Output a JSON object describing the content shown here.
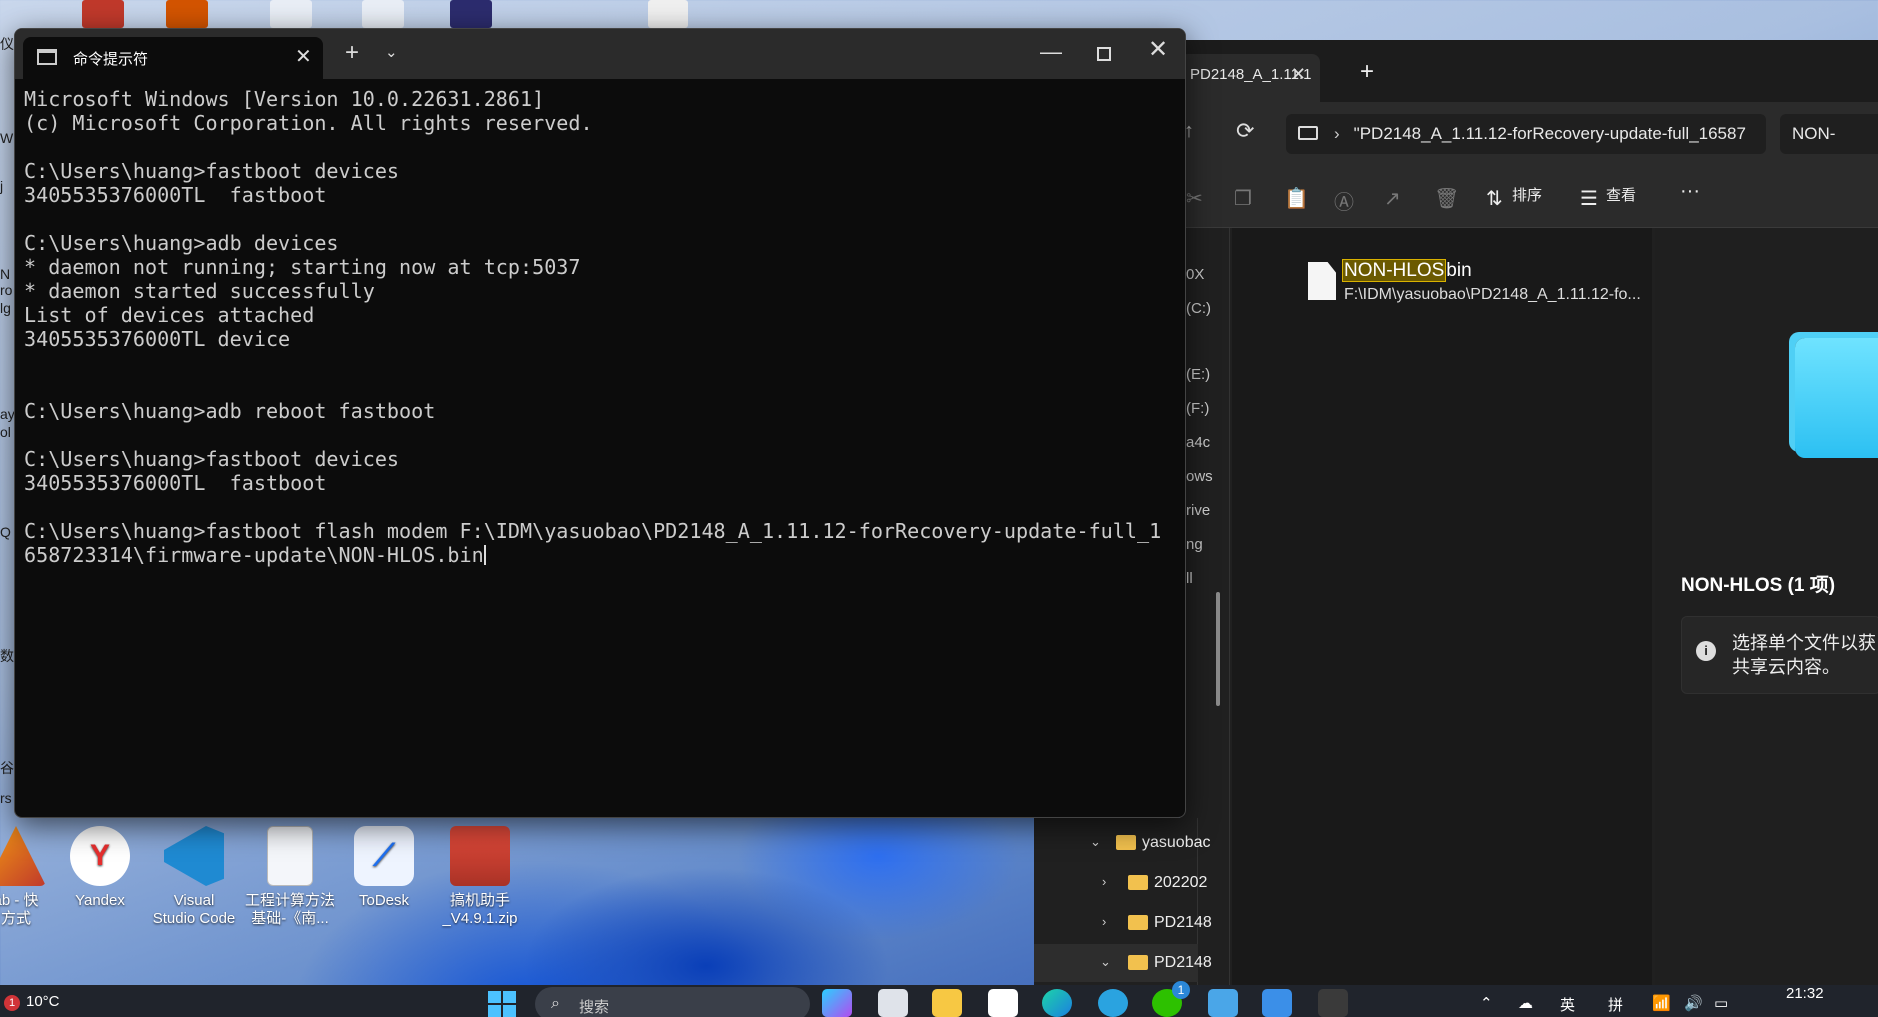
{
  "desktop": {
    "icons": [
      {
        "label": "ab - 快\n方式"
      },
      {
        "label": "Yandex"
      },
      {
        "label": "Visual\nStudio Code"
      },
      {
        "label": "工程计算方法\n基础-《南..."
      },
      {
        "label": "ToDesk"
      },
      {
        "label": "搞机助手\n_V4.9.1.zip"
      }
    ],
    "left_edge_fragments": [
      "仪",
      "W",
      "j",
      "N",
      "ro",
      "lg",
      "ay",
      "ol",
      "Q",
      "数",
      "谷",
      "rs"
    ]
  },
  "terminal": {
    "tab_title": "命令提示符",
    "lines": [
      "Microsoft Windows [Version 10.0.22631.2861]",
      "(c) Microsoft Corporation. All rights reserved.",
      "",
      "C:\\Users\\huang>fastboot devices",
      "3405535376000TL  fastboot",
      "",
      "C:\\Users\\huang>adb devices",
      "* daemon not running; starting now at tcp:5037",
      "* daemon started successfully",
      "List of devices attached",
      "3405535376000TL device",
      "",
      "",
      "C:\\Users\\huang>adb reboot fastboot",
      "",
      "C:\\Users\\huang>fastboot devices",
      "3405535376000TL  fastboot",
      "",
      "C:\\Users\\huang>fastboot flash modem F:\\IDM\\yasuobao\\PD2148_A_1.11.12-forRecovery-update-full_1",
      "658723314\\firmware-update\\NON-HLOS.bin"
    ]
  },
  "explorer": {
    "tab_title": "PD2148_A_1.11.1",
    "address_text": "\"PD2148_A_1.11.12-forRecovery-update-full_16587",
    "search_text": "NON-",
    "toolbar": {
      "sort_label": "排序",
      "view_label": "查看",
      "more_label": "···"
    },
    "nav_fragments": [
      "0X",
      "(C:)",
      "(E:)",
      "(F:)",
      "a4c",
      "ows",
      "rive",
      "ng",
      "ll"
    ],
    "file": {
      "name_highlight": "NON-HLOS",
      "name_rest": "bin",
      "path": "F:\\IDM\\yasuobao\\PD2148_A_1.11.12-fo..."
    },
    "details": {
      "title": "NON-HLOS (1 项)",
      "info_line1": "选择单个文件以获",
      "info_line2": "共享云内容。"
    },
    "tree": [
      {
        "label": "yasuobac",
        "state": "expanded"
      },
      {
        "label": "202202",
        "state": "collapsed"
      },
      {
        "label": "PD2148",
        "state": "collapsed"
      },
      {
        "label": "PD2148",
        "state": "expanded"
      }
    ]
  },
  "taskbar": {
    "weather_temp": "10°C",
    "weather_alert": "1",
    "search_placeholder": "搜索",
    "badge_count": "1",
    "tray": {
      "lang": "英",
      "ime": "拼"
    },
    "clock": "21:32"
  },
  "colors": {
    "terminal_bg": "#0c0c0c",
    "terminal_text": "#cccccc",
    "explorer_bg": "#202020",
    "highlight": "#d9b200",
    "accent": "#4cc2ff"
  }
}
